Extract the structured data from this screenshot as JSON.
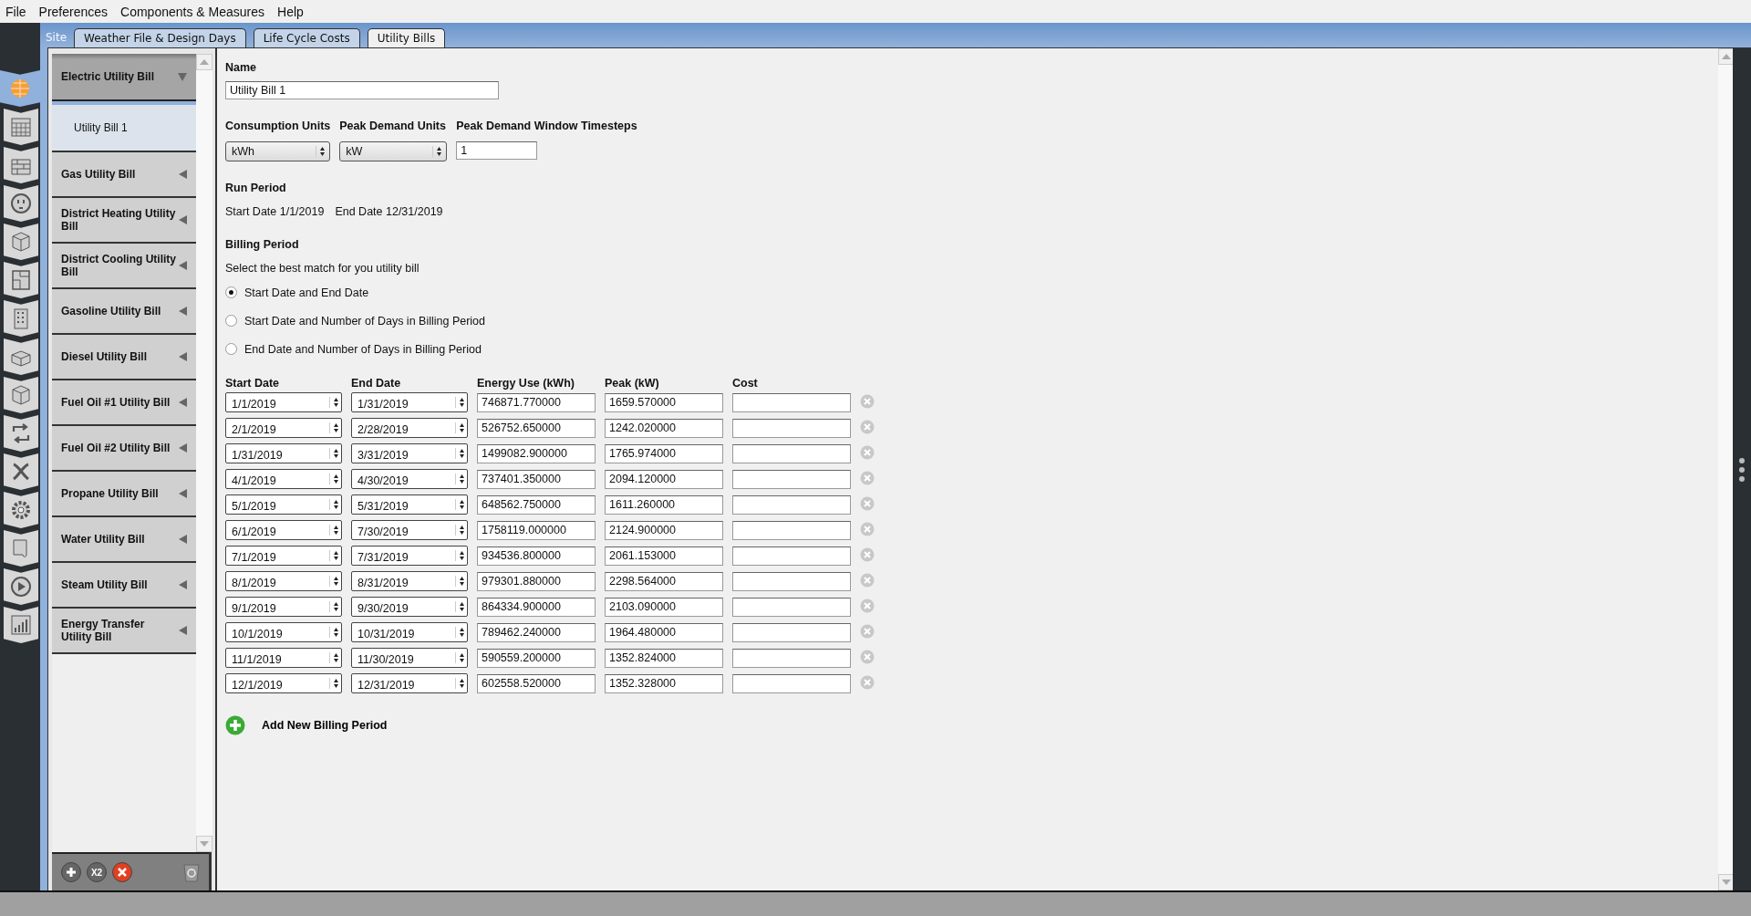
{
  "menu": [
    "File",
    "Preferences",
    "Components & Measures",
    "Help"
  ],
  "site_label": "Site",
  "tabs": [
    {
      "label": "Weather File & Design Days",
      "selected": false
    },
    {
      "label": "Life Cycle Costs",
      "selected": false
    },
    {
      "label": "Utility Bills",
      "selected": true
    }
  ],
  "nav": [
    {
      "selected": true
    },
    {
      "selected": false
    },
    {
      "selected": false
    },
    {
      "selected": false
    },
    {
      "selected": false
    },
    {
      "selected": false
    },
    {
      "selected": false
    },
    {
      "selected": false
    },
    {
      "selected": false
    },
    {
      "selected": false
    },
    {
      "selected": false
    },
    {
      "selected": false
    },
    {
      "selected": false
    },
    {
      "selected": false
    },
    {
      "selected": false
    }
  ],
  "sidebar": {
    "items": [
      {
        "label": "Electric Utility Bill",
        "expanded": true,
        "children": [
          {
            "label": "Utility Bill 1",
            "selected": true
          }
        ]
      },
      {
        "label": "Gas Utility Bill",
        "expanded": false
      },
      {
        "label": "District Heating Utility Bill",
        "expanded": false
      },
      {
        "label": "District Cooling Utility Bill",
        "expanded": false
      },
      {
        "label": "Gasoline Utility Bill",
        "expanded": false
      },
      {
        "label": "Diesel Utility Bill",
        "expanded": false
      },
      {
        "label": "Fuel Oil #1 Utility Bill",
        "expanded": false
      },
      {
        "label": "Fuel Oil #2 Utility Bill",
        "expanded": false
      },
      {
        "label": "Propane Utility Bill",
        "expanded": false
      },
      {
        "label": "Water Utility Bill",
        "expanded": false
      },
      {
        "label": "Steam Utility Bill",
        "expanded": false
      },
      {
        "label": "Energy Transfer Utility Bill",
        "expanded": false
      }
    ],
    "toolbar": {
      "duplicate_label": "X2"
    }
  },
  "form": {
    "name_label": "Name",
    "name_value": "Utility Bill 1",
    "consumption_units_label": "Consumption Units",
    "consumption_units": "kWh",
    "peak_demand_units_label": "Peak Demand Units",
    "peak_demand_units": "kW",
    "timesteps_label": "Peak Demand Window Timesteps",
    "timesteps": "1",
    "run_period_label": "Run Period",
    "run_start": "Start Date 1/1/2019",
    "run_end": "End Date 12/31/2019",
    "billing_period_label": "Billing Period",
    "billing_hint": "Select the best match for you utility bill",
    "billing_options": [
      {
        "label": "Start Date and End Date",
        "selected": true
      },
      {
        "label": "Start Date and Number of Days in Billing Period",
        "selected": false
      },
      {
        "label": "End Date and Number of Days in Billing Period",
        "selected": false
      }
    ]
  },
  "table": {
    "columns": [
      "Start Date",
      "End Date",
      "Energy Use (kWh)",
      "Peak (kW)",
      "Cost"
    ],
    "rows": [
      {
        "start": "1/1/2019",
        "end": "1/31/2019",
        "energy": "746871.770000",
        "peak": "1659.570000"
      },
      {
        "start": "2/1/2019",
        "end": "2/28/2019",
        "energy": "526752.650000",
        "peak": "1242.020000"
      },
      {
        "start": "1/31/2019",
        "end": "3/31/2019",
        "energy": "1499082.900000",
        "peak": "1765.974000"
      },
      {
        "start": "4/1/2019",
        "end": "4/30/2019",
        "energy": "737401.350000",
        "peak": "2094.120000"
      },
      {
        "start": "5/1/2019",
        "end": "5/31/2019",
        "energy": "648562.750000",
        "peak": "1611.260000"
      },
      {
        "start": "6/1/2019",
        "end": "7/30/2019",
        "energy": "1758119.000000",
        "peak": "2124.900000"
      },
      {
        "start": "7/1/2019",
        "end": "7/31/2019",
        "energy": "934536.800000",
        "peak": "2061.153000"
      },
      {
        "start": "8/1/2019",
        "end": "8/31/2019",
        "energy": "979301.880000",
        "peak": "2298.564000"
      },
      {
        "start": "9/1/2019",
        "end": "9/30/2019",
        "energy": "864334.900000",
        "peak": "2103.090000"
      },
      {
        "start": "10/1/2019",
        "end": "10/31/2019",
        "energy": "789462.240000",
        "peak": "1964.480000"
      },
      {
        "start": "11/1/2019",
        "end": "11/30/2019",
        "energy": "590559.200000",
        "peak": "1352.824000"
      },
      {
        "start": "12/1/2019",
        "end": "12/31/2019",
        "energy": "602558.520000",
        "peak": "1352.328000"
      }
    ]
  },
  "add_button": "Add New Billing Period"
}
